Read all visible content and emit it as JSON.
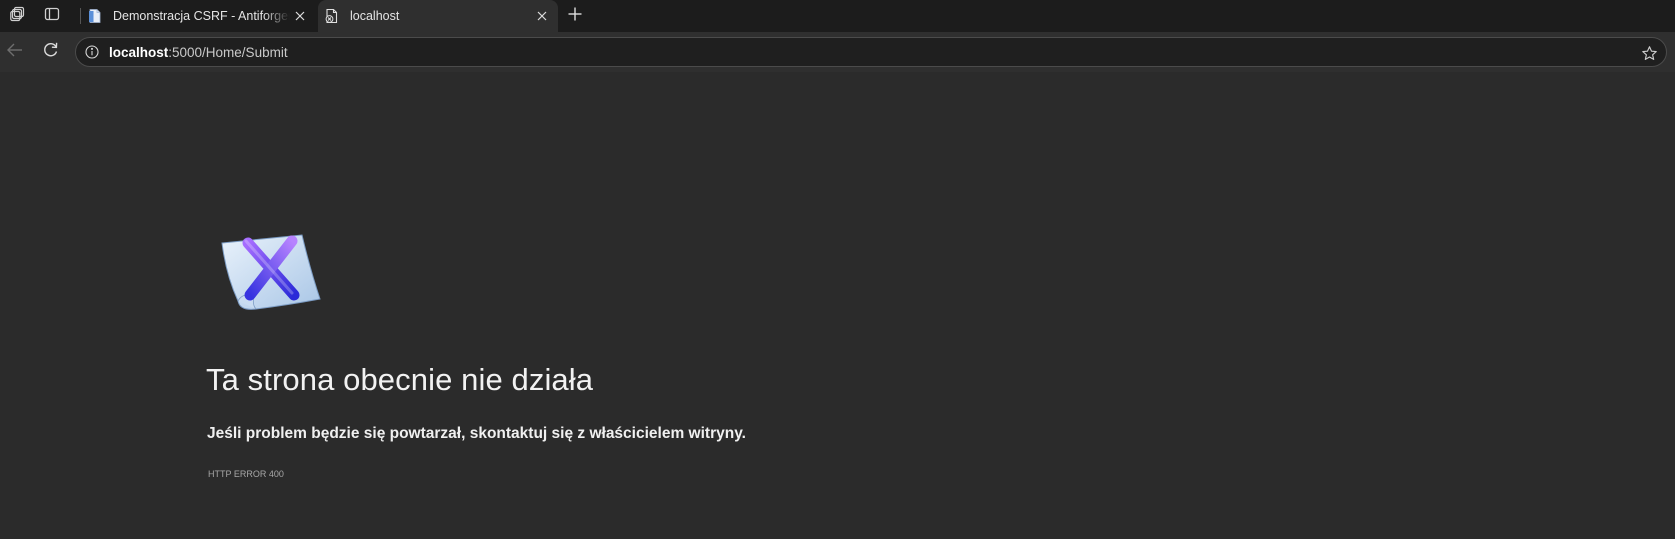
{
  "browser": {
    "tabs": [
      {
        "title": "Demonstracja CSRF - AntiforgeryDemo",
        "favicon": "document-icon",
        "active": false
      },
      {
        "title": "localhost",
        "favicon": "page-error-icon",
        "active": true
      }
    ],
    "strip_icons": [
      "workspaces-icon",
      "tab-actions-icon"
    ],
    "new_tab_icon": "plus-icon"
  },
  "toolbar": {
    "url_host": "localhost",
    "url_rest": ":5000/Home/Submit",
    "icons": [
      "back-arrow-icon",
      "reload-icon",
      "info-icon",
      "star-icon"
    ]
  },
  "page": {
    "icon": "broken-page-icon",
    "heading": "Ta strona obecnie nie działa",
    "subtext": "Jeśli problem będzie się powtarzał, skontaktuj się z właścicielem witryny.",
    "error_code": "HTTP ERROR 400"
  },
  "colors": {
    "tabstrip_bg": "#1c1c1c",
    "toolbar_bg": "#2f2f2f",
    "page_bg": "#2b2b2b",
    "accent_x": "#4d3fe0"
  }
}
